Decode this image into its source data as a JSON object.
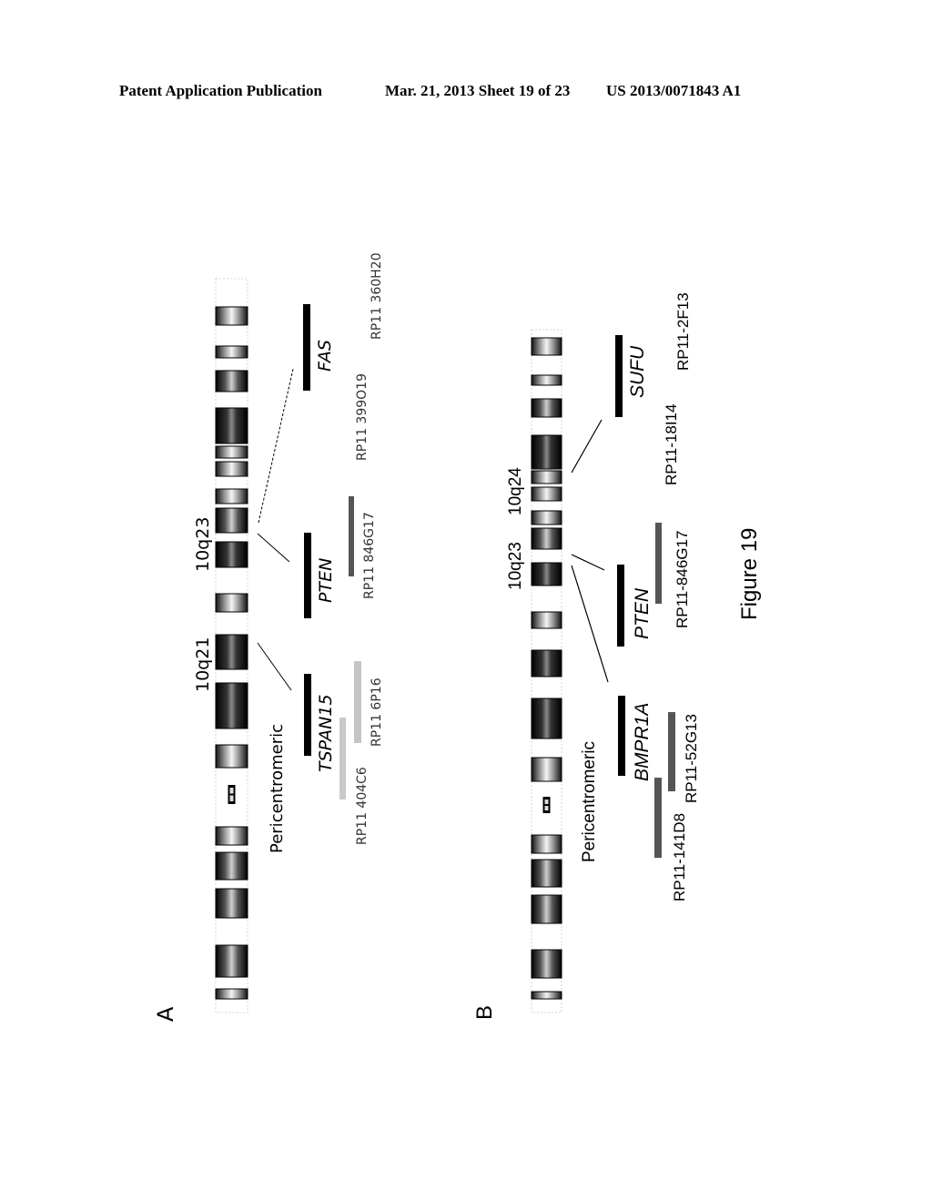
{
  "header": {
    "left": "Patent Application Publication",
    "middle": "Mar. 21, 2013  Sheet 19 of 23",
    "right": "US 2013/0071843 A1"
  },
  "figure": {
    "caption": "Figure 19",
    "orientation": "rotated 90 degrees counter-clockwise",
    "panel_a": {
      "label": "A",
      "chromosome": "10",
      "band_labels": [
        "10q21",
        "10q23"
      ],
      "region_label": "Pericentromeric",
      "genes": [
        {
          "name": "TSPAN15",
          "italic": true
        },
        {
          "name": "PTEN",
          "italic": true
        },
        {
          "name": "FAS",
          "italic": true
        }
      ],
      "clones": [
        {
          "name": "RP11 404C6",
          "shade": "light"
        },
        {
          "name": "RP11 6P16",
          "shade": "light"
        },
        {
          "name": "RP11 846G17",
          "shade": "dark"
        },
        {
          "name": "RP11 399O19",
          "shade": "none"
        },
        {
          "name": "RP11 360H20",
          "shade": "none"
        }
      ]
    },
    "panel_b": {
      "label": "B",
      "chromosome": "10",
      "band_labels": [
        "10q23",
        "10q24"
      ],
      "region_label": "Pericentromeric",
      "genes": [
        {
          "name": "BMPR1A",
          "italic": true
        },
        {
          "name": "PTEN",
          "italic": true
        },
        {
          "name": "SUFU",
          "italic": true
        }
      ],
      "clones": [
        {
          "name": "RP11-141D8",
          "shade": "dark"
        },
        {
          "name": "RP11-52G13",
          "shade": "dark"
        },
        {
          "name": "RP11-846G17",
          "shade": "dark"
        },
        {
          "name": "RP11-18I14",
          "shade": "none"
        },
        {
          "name": "RP11-2F13",
          "shade": "none"
        }
      ]
    }
  }
}
